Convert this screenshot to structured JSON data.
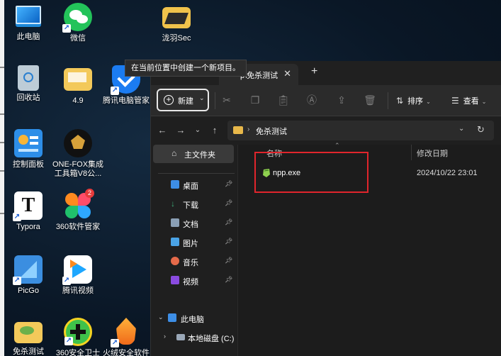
{
  "desktop": {
    "icons": [
      {
        "name": "this-pc",
        "label": "此电脑"
      },
      {
        "name": "wechat",
        "label": "微信"
      },
      {
        "name": "longyu-sec",
        "label": "泷羽Sec"
      },
      {
        "name": "recycle-bin",
        "label": "回收站"
      },
      {
        "name": "folder-4-9",
        "label": "4.9"
      },
      {
        "name": "tencent-pc-manager",
        "label": "腾讯电脑管家"
      },
      {
        "name": "control-panel",
        "label": "控制面板"
      },
      {
        "name": "one-fox",
        "label": "ONE-FOX集成工具箱V8公..."
      },
      {
        "name": "typora",
        "label": "Typora"
      },
      {
        "name": "360-software",
        "label": "360软件管家",
        "badge": "2"
      },
      {
        "name": "picgo",
        "label": "PicGo"
      },
      {
        "name": "tencent-video",
        "label": "腾讯视频"
      },
      {
        "name": "mianshaceshi",
        "label": "免杀测试"
      },
      {
        "name": "360-guard",
        "label": "360安全卫士"
      },
      {
        "name": "huorong",
        "label": "火绒安全软件"
      }
    ]
  },
  "explorer": {
    "tab_title": "p\\免杀测试",
    "tooltip": "在当前位置中创建一个新项目。",
    "toolbar": {
      "new_label": "新建",
      "sort_label": "排序",
      "view_label": "查看"
    },
    "address": {
      "path": "免杀测试"
    },
    "sidebar": {
      "home_label": "主文件夹",
      "items": [
        {
          "label": "桌面"
        },
        {
          "label": "下载"
        },
        {
          "label": "文档"
        },
        {
          "label": "图片"
        },
        {
          "label": "音乐"
        },
        {
          "label": "视频"
        },
        {
          "label": "此电脑"
        },
        {
          "label": "本地磁盘 (C:)"
        }
      ]
    },
    "columns": {
      "name": "名称",
      "date": "修改日期"
    },
    "files": [
      {
        "name": "npp.exe",
        "date": "2024/10/22 23:01"
      }
    ]
  }
}
